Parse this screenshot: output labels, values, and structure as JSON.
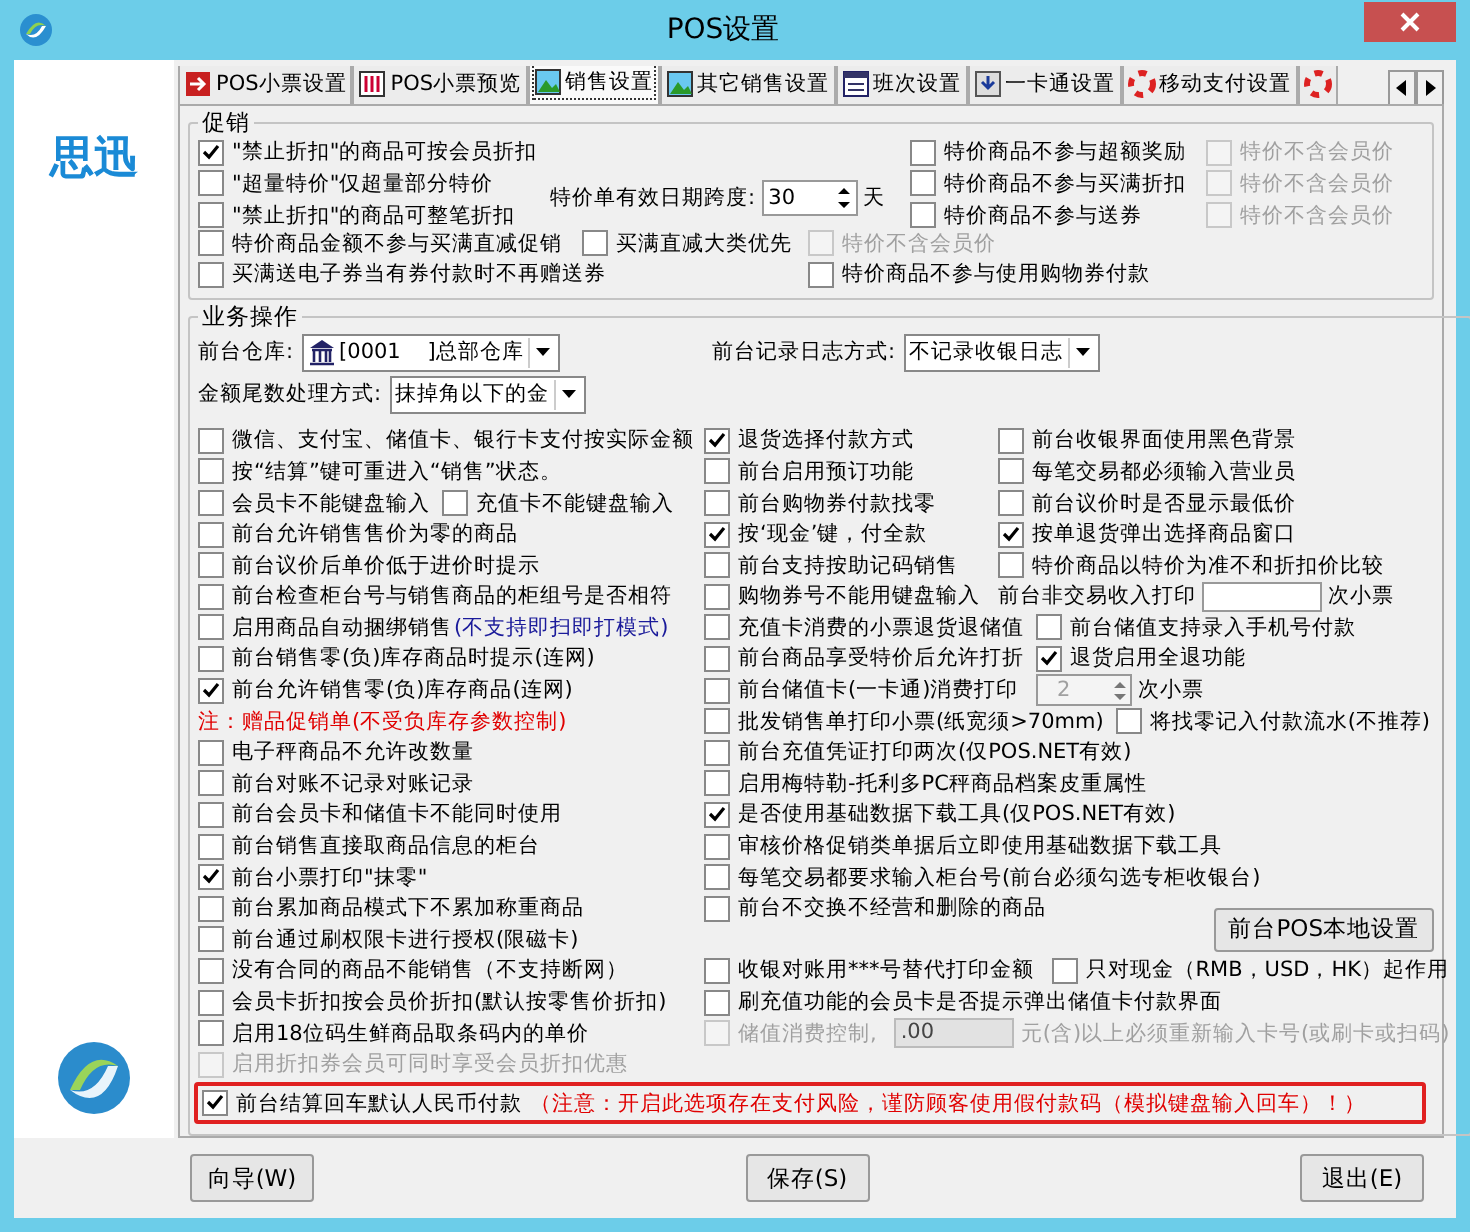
{
  "window": {
    "title": "POS设置"
  },
  "sidebar": {
    "brand": "思迅"
  },
  "tabs": [
    {
      "label": "POS小票设置",
      "selected": false
    },
    {
      "label": "POS小票预览",
      "selected": false
    },
    {
      "label": "销售设置",
      "selected": true
    },
    {
      "label": "其它销售设置",
      "selected": false
    },
    {
      "label": "班次设置",
      "selected": false
    },
    {
      "label": "一卡通设置",
      "selected": false
    },
    {
      "label": "移动支付设置",
      "selected": false
    },
    {
      "selected": false
    }
  ],
  "promo": {
    "title": "促销",
    "left": [
      {
        "label": "\"禁止折扣\"的商品可按会员折扣",
        "checked": true,
        "disabled": false
      },
      {
        "label": "\"超量特价\"仅超量部分特价",
        "checked": false,
        "disabled": false
      },
      {
        "label": "\"禁止折扣\"的商品可整笔折扣",
        "checked": false,
        "disabled": false
      }
    ],
    "date_span": {
      "label": "特价单有效日期跨度:",
      "value": "30",
      "unit": "天"
    },
    "right": [
      {
        "option": {
          "label": "特价商品不参与超额奖励",
          "checked": false,
          "disabled": false
        },
        "sub": {
          "label": "特价不含会员价",
          "checked": false,
          "disabled": true
        }
      },
      {
        "option": {
          "label": "特价商品不参与买满折扣",
          "checked": false,
          "disabled": false
        },
        "sub": {
          "label": "特价不含会员价",
          "checked": false,
          "disabled": true
        }
      },
      {
        "option": {
          "label": "特价商品不参与送券",
          "checked": false,
          "disabled": false
        },
        "sub": {
          "label": "特价不含会员价",
          "checked": false,
          "disabled": true
        }
      }
    ],
    "rows": [
      {
        "left": [
          {
            "kind": "checkbox",
            "label": "特价商品金额不参与买满直减促销",
            "checked": false,
            "disabled": false
          }
        ],
        "mid": [
          {
            "kind": "checkbox",
            "label": "买满直减大类优先",
            "checked": false,
            "disabled": false
          }
        ],
        "right": [
          {
            "kind": "checkbox",
            "label": "特价不含会员价",
            "checked": false,
            "disabled": true
          }
        ]
      },
      {
        "left": [
          {
            "kind": "checkbox",
            "label": "买满送电子券当有券付款时不再赠送券",
            "checked": false,
            "disabled": false
          }
        ],
        "right": [
          {
            "kind": "checkbox",
            "label": "特价商品不参与使用购物券付款",
            "checked": false,
            "disabled": false
          }
        ]
      }
    ]
  },
  "business": {
    "title": "业务操作",
    "store": {
      "label": "前台仓库:",
      "value": "[0001    ]总部仓库"
    },
    "log_mode": {
      "label": "前台记录日志方式:",
      "value": "不记录收银日志"
    },
    "rounding": {
      "label": "金额尾数处理方式:",
      "value": "抹掉角以下的金"
    },
    "rows": [
      {
        "left": [
          {
            "kind": "checkbox",
            "label": "微信、支付宝、储值卡、银行卡支付按实际金额",
            "checked": false,
            "disabled": false
          }
        ],
        "mid": [
          {
            "kind": "checkbox",
            "label": "退货选择付款方式",
            "checked": true,
            "disabled": false
          }
        ],
        "right": [
          {
            "kind": "checkbox",
            "label": "前台收银界面使用黑色背景",
            "checked": false,
            "disabled": false
          }
        ]
      },
      {
        "left": [
          {
            "kind": "checkbox",
            "label": "按“结算”键可重进入“销售”状态。",
            "checked": false,
            "disabled": false
          }
        ],
        "mid": [
          {
            "kind": "checkbox",
            "label": "前台启用预订功能",
            "checked": false,
            "disabled": false
          }
        ],
        "right": [
          {
            "kind": "checkbox",
            "label": "每笔交易都必须输入营业员",
            "checked": false,
            "disabled": false
          }
        ]
      },
      {
        "left": [
          {
            "kind": "checkbox",
            "label": "会员卡不能键盘输入",
            "checked": false,
            "disabled": false
          },
          {
            "kind": "checkbox",
            "label": "充值卡不能键盘输入",
            "checked": false,
            "disabled": false
          }
        ],
        "mid": [
          {
            "kind": "checkbox",
            "label": "前台购物券付款找零",
            "checked": false,
            "disabled": false
          }
        ],
        "right": [
          {
            "kind": "checkbox",
            "label": "前台议价时是否显示最低价",
            "checked": false,
            "disabled": false
          }
        ]
      },
      {
        "left": [
          {
            "kind": "checkbox",
            "label": "前台允许销售售价为零的商品",
            "checked": false,
            "disabled": false
          }
        ],
        "mid": [
          {
            "kind": "checkbox",
            "label": "按‘现金’键，付全款",
            "checked": true,
            "disabled": false
          }
        ],
        "right": [
          {
            "kind": "checkbox",
            "label": "按单退货弹出选择商品窗口",
            "checked": true,
            "disabled": false
          }
        ]
      },
      {
        "left": [
          {
            "kind": "checkbox",
            "label": "前台议价后单价低于进价时提示",
            "checked": false,
            "disabled": false
          }
        ],
        "mid": [
          {
            "kind": "checkbox",
            "label": "前台支持按助记码销售",
            "checked": false,
            "disabled": false
          }
        ],
        "right": [
          {
            "kind": "checkbox",
            "label": "特价商品以特价为准不和折扣价比较",
            "checked": false,
            "disabled": false
          }
        ]
      },
      {
        "left": [
          {
            "kind": "checkbox",
            "label": "前台检查柜台号与销售商品的柜组号是否相符",
            "checked": false,
            "disabled": false
          }
        ],
        "mid": [
          {
            "kind": "checkbox",
            "label": "购物券号不能用键盘输入",
            "checked": false,
            "disabled": false
          },
          {
            "kind": "label",
            "label": "前台非交易收入打印"
          },
          {
            "kind": "input",
            "disabled": false
          },
          {
            "kind": "label",
            "label": "次小票"
          }
        ]
      },
      {
        "left": [
          {
            "kind": "checkbox",
            "label": "启用商品自动捆绑销售",
            "hint": "(不支持即扫即打模式)",
            "checked": false,
            "disabled": false
          }
        ],
        "mid": [
          {
            "kind": "checkbox",
            "label": "充值卡消费的小票退货退储值",
            "checked": false,
            "disabled": false
          }
        ],
        "right": [
          {
            "kind": "checkbox",
            "label": "前台储值支持录入手机号付款",
            "checked": false,
            "disabled": false
          }
        ]
      },
      {
        "left": [
          {
            "kind": "checkbox",
            "label": "前台销售零(负)库存商品时提示(连网)",
            "checked": false,
            "disabled": false
          }
        ],
        "mid": [
          {
            "kind": "checkbox",
            "label": "前台商品享受特价后允许打折",
            "checked": false,
            "disabled": false
          }
        ],
        "right": [
          {
            "kind": "checkbox",
            "label": "退货启用全退功能",
            "checked": true,
            "disabled": false
          }
        ]
      },
      {
        "left": [
          {
            "kind": "checkbox",
            "label": "前台允许销售零(负)库存商品(连网)",
            "checked": true,
            "disabled": false
          }
        ],
        "mid": [
          {
            "kind": "checkbox",
            "label": "前台储值卡(一卡通)消费打印",
            "checked": false,
            "disabled": false
          },
          {
            "kind": "spin",
            "value": "2",
            "disabled": true
          },
          {
            "kind": "label",
            "label": "次小票"
          }
        ]
      },
      {
        "left": [
          {
            "kind": "note",
            "label": "注：赠品促销单(不受负库存参数控制)"
          }
        ],
        "mid": [
          {
            "kind": "checkbox",
            "label": "批发销售单打印小票(纸宽须>70mm)",
            "checked": false,
            "disabled": false
          }
        ],
        "right": [
          {
            "kind": "checkbox",
            "label": "将找零记入付款流水(不推荐)",
            "checked": false,
            "disabled": false
          }
        ]
      },
      {
        "left": [
          {
            "kind": "checkbox",
            "label": "电子秤商品不允许改数量",
            "checked": false,
            "disabled": false
          }
        ],
        "mid": [
          {
            "kind": "checkbox",
            "label": "前台充值凭证打印两次(仅POS.NET有效)",
            "checked": false,
            "disabled": false
          }
        ]
      },
      {
        "left": [
          {
            "kind": "checkbox",
            "label": "前台对账不记录对账记录",
            "checked": false,
            "disabled": false
          }
        ],
        "mid": [
          {
            "kind": "checkbox",
            "label": "启用梅特勒-托利多PC秤商品档案皮重属性",
            "checked": false,
            "disabled": false
          }
        ]
      },
      {
        "left": [
          {
            "kind": "checkbox",
            "label": "前台会员卡和储值卡不能同时使用",
            "checked": false,
            "disabled": false
          }
        ],
        "mid": [
          {
            "kind": "checkbox",
            "label": "是否使用基础数据下载工具(仅POS.NET有效)",
            "checked": true,
            "disabled": false
          }
        ]
      },
      {
        "left": [
          {
            "kind": "checkbox",
            "label": "前台销售直接取商品信息的柜台",
            "checked": false,
            "disabled": false
          }
        ],
        "mid": [
          {
            "kind": "checkbox",
            "label": "审核价格促销类单据后立即使用基础数据下载工具",
            "checked": false,
            "disabled": false
          }
        ]
      },
      {
        "left": [
          {
            "kind": "checkbox",
            "label": "前台小票打印\"抹零\"",
            "checked": true,
            "disabled": false
          }
        ],
        "mid": [
          {
            "kind": "checkbox",
            "label": "每笔交易都要求输入柜台号(前台必须勾选专柜收银台)",
            "checked": false,
            "disabled": false
          }
        ]
      },
      {
        "left": [
          {
            "kind": "checkbox",
            "label": "前台累加商品模式下不累加称重商品",
            "checked": false,
            "disabled": false
          }
        ],
        "mid": [
          {
            "kind": "checkbox",
            "label": "前台不交换不经营和删除的商品",
            "checked": false,
            "disabled": false
          }
        ]
      },
      {
        "left": [
          {
            "kind": "checkbox",
            "label": "前台通过刷权限卡进行授权(限磁卡)",
            "checked": false,
            "disabled": false
          }
        ],
        "right": [
          {
            "kind": "button",
            "label": "前台POS本地设置"
          }
        ]
      },
      {
        "left": [
          {
            "kind": "checkbox",
            "label": "没有合同的商品不能销售（不支持断网）",
            "checked": false,
            "disabled": false
          }
        ],
        "mid": [
          {
            "kind": "checkbox",
            "label": "收银对账用***号替代打印金额",
            "checked": false,
            "disabled": false
          },
          {
            "kind": "checkbox",
            "label": "只对现金（RMB，USD，HK）起作用",
            "checked": false,
            "disabled": false
          }
        ]
      },
      {
        "left": [
          {
            "kind": "checkbox",
            "label": "会员卡折扣按会员价折扣(默认按零售价折扣)",
            "checked": false,
            "disabled": false
          }
        ],
        "mid": [
          {
            "kind": "checkbox",
            "label": "刷充值功能的会员卡是否提示弹出储值卡付款界面",
            "checked": false,
            "disabled": false
          }
        ]
      },
      {
        "left": [
          {
            "kind": "checkbox",
            "label": "启用18位码生鲜商品取条码内的单价",
            "checked": false,
            "disabled": false
          }
        ],
        "mid": [
          {
            "kind": "checkbox",
            "label": "储值消费控制,",
            "checked": false,
            "disabled": true
          },
          {
            "kind": "input",
            "value": ".00",
            "disabled": true
          },
          {
            "kind": "dimtext",
            "label": "元(含)以上必须重新输入卡号(或刷卡或扫码)"
          }
        ]
      },
      {
        "left": [
          {
            "kind": "checkbox",
            "label": "启用折扣券会员可同时享受会员折扣优惠",
            "checked": false,
            "disabled": true
          }
        ]
      }
    ],
    "alert": {
      "label": "前台结算回车默认人民币付款",
      "warning": "（注意：开启此选项存在支付风险，谨防顾客使用假付款码（模拟键盘输入回车）！）",
      "checked": true,
      "disabled": false
    }
  },
  "buttons": [
    "向导(W)",
    "保存(S)",
    "退出(E)"
  ]
}
